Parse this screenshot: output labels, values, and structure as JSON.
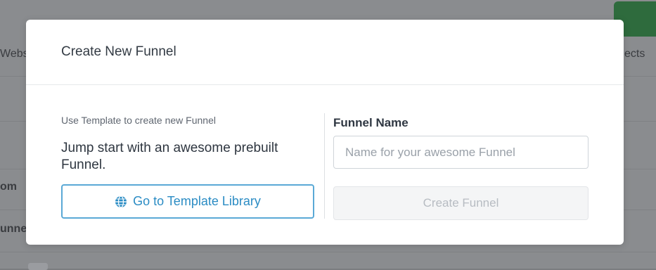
{
  "background": {
    "fragments": [
      "Websi",
      "ects",
      "om",
      "unne"
    ]
  },
  "modal": {
    "title": "Create New Funnel",
    "left": {
      "hint": "Use Template to create new Funnel",
      "lead": "Jump start with an awesome prebuilt Funnel.",
      "template_button": {
        "label": "Go to Template Library",
        "icon": "globe-icon"
      }
    },
    "right": {
      "field_label": "Funnel Name",
      "name_input": {
        "value": "",
        "placeholder": "Name for your awesome Funnel"
      },
      "create_button": {
        "label": "Create Funnel",
        "state": "disabled"
      }
    }
  },
  "colors": {
    "accent": "#2b8cc4",
    "accent_border": "#5aa9d6",
    "overlay": "#8a8c8f",
    "bg_green": "#2e6b3d"
  }
}
